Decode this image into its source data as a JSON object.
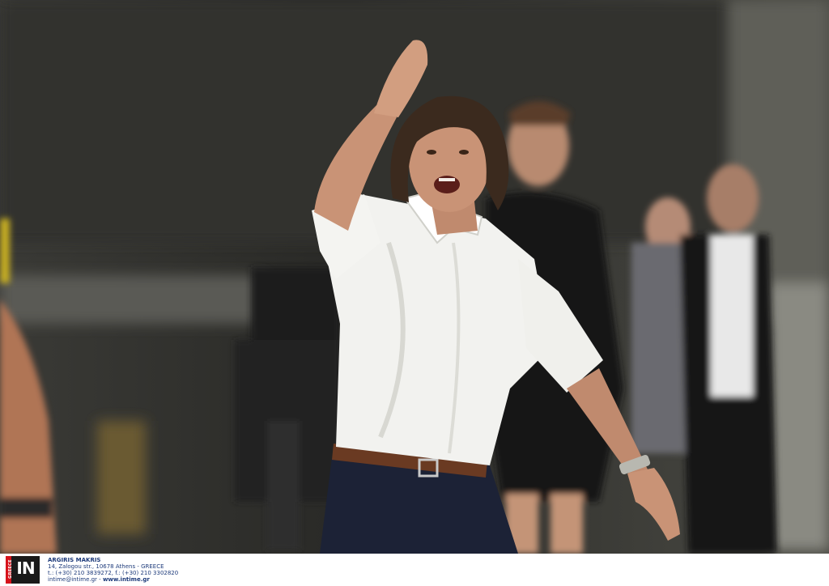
{
  "photo": {
    "subject": "",
    "colors": {
      "shirt": "#f2f2ef",
      "trousers": "#1c2236",
      "belt": "#6a3a22",
      "background": "#2b2b28"
    }
  },
  "credit": {
    "logo_text": "IN",
    "logo_strip_text": "GREECE",
    "photographer": "ARGIRIS MAKRIS",
    "address": "14, Zalogou str., 10678 Athens - GREECE",
    "phone": "t.: (+30) 210 3839272, f.: (+30) 210 3302820",
    "email": "intime@intime.gr",
    "separator": " - ",
    "website": "www.intime.gr",
    "brand_color": "#d6121b"
  }
}
